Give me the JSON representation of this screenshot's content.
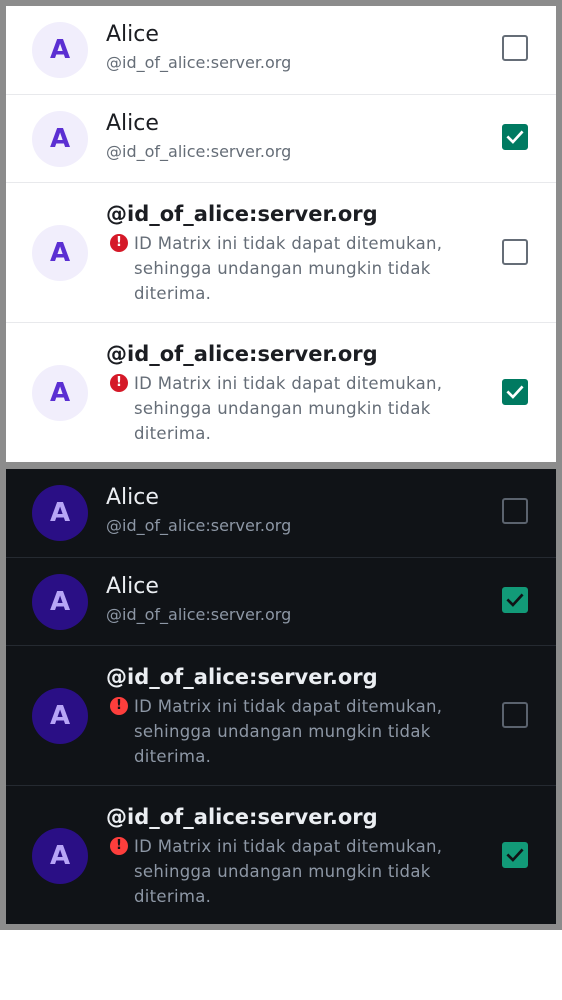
{
  "light_theme": {
    "rows": [
      {
        "avatar": "A",
        "name": "Alice",
        "user_id": "@id_of_alice:server.org",
        "checked": false
      },
      {
        "avatar": "A",
        "name": "Alice",
        "user_id": "@id_of_alice:server.org",
        "checked": true
      },
      {
        "avatar": "A",
        "name": "@id_of_alice:server.org",
        "warning": "ID Matrix ini tidak dapat ditemukan, sehingga undangan mungkin tidak diterima.",
        "checked": false
      },
      {
        "avatar": "A",
        "name": "@id_of_alice:server.org",
        "warning": "ID Matrix ini tidak dapat ditemukan, sehingga undangan mungkin tidak diterima.",
        "checked": true
      }
    ]
  },
  "dark_theme": {
    "rows": [
      {
        "avatar": "A",
        "name": "Alice",
        "user_id": "@id_of_alice:server.org",
        "checked": false
      },
      {
        "avatar": "A",
        "name": "Alice",
        "user_id": "@id_of_alice:server.org",
        "checked": true
      },
      {
        "avatar": "A",
        "name": "@id_of_alice:server.org",
        "warning": "ID Matrix ini tidak dapat ditemukan, sehingga undangan mungkin tidak diterima.",
        "checked": false
      },
      {
        "avatar": "A",
        "name": "@id_of_alice:server.org",
        "warning": "ID Matrix ini tidak dapat ditemukan, sehingga undangan mungkin tidak diterima.",
        "checked": true
      }
    ]
  },
  "icons": {
    "warning": "error-icon",
    "checked": "check-icon",
    "warning_glyph": "!"
  },
  "colors": {
    "light_accent": "#007a61",
    "dark_accent": "#129a78",
    "light_error": "#d51928",
    "dark_error": "#fd3e3c",
    "light_avatar_bg": "#f1eefc",
    "dark_avatar_bg": "#2a0f85",
    "dark_background": "#101317"
  }
}
